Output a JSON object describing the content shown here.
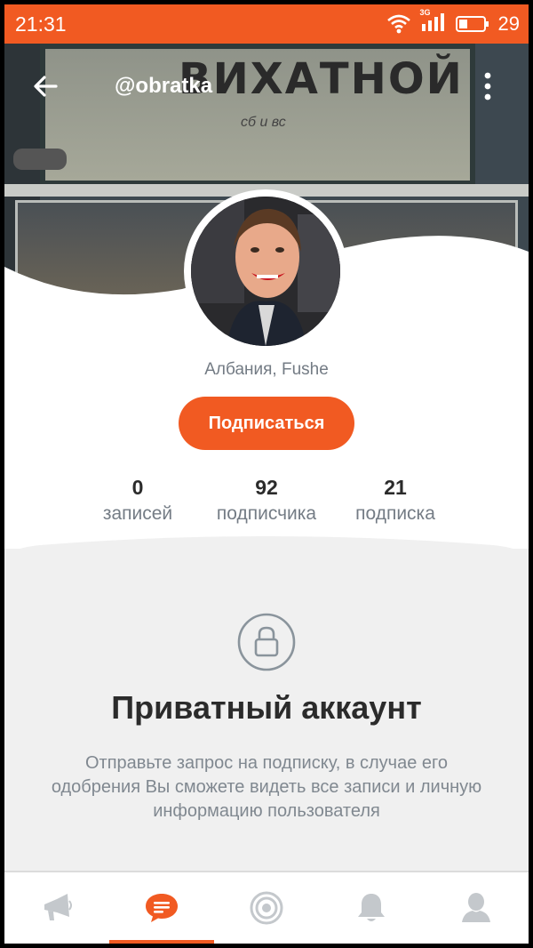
{
  "status_bar": {
    "time": "21:31",
    "network_label": "3G",
    "battery": "29"
  },
  "header": {
    "username": "@obratka",
    "back_icon": "arrow-left-icon",
    "menu_icon": "more-vertical-icon"
  },
  "cover": {
    "sign_text": "ВИХАТНОЙ",
    "sign_small_text": "сб и вс"
  },
  "profile": {
    "location": "Албания, Fushe",
    "subscribe_label": "Подписаться"
  },
  "stats": [
    {
      "value": "0",
      "label": "записей"
    },
    {
      "value": "92",
      "label": "подписчика"
    },
    {
      "value": "21",
      "label": "подписка"
    }
  ],
  "private_account": {
    "icon": "lock-icon",
    "title": "Приватный аккаунт",
    "description": "Отправьте запрос на подписку, в случае его одобрения Вы сможете видеть все записи и личную информацию пользователя"
  },
  "bottom_nav": {
    "items": [
      {
        "icon": "megaphone-icon",
        "active": false
      },
      {
        "icon": "chat-icon",
        "active": true
      },
      {
        "icon": "target-icon",
        "active": false
      },
      {
        "icon": "bell-icon",
        "active": false
      },
      {
        "icon": "profile-icon",
        "active": false
      }
    ]
  },
  "colors": {
    "accent": "#f15a22",
    "inactive_icon": "#c4c8cc",
    "text_primary": "#2b2b2b",
    "text_secondary": "#747c85"
  }
}
